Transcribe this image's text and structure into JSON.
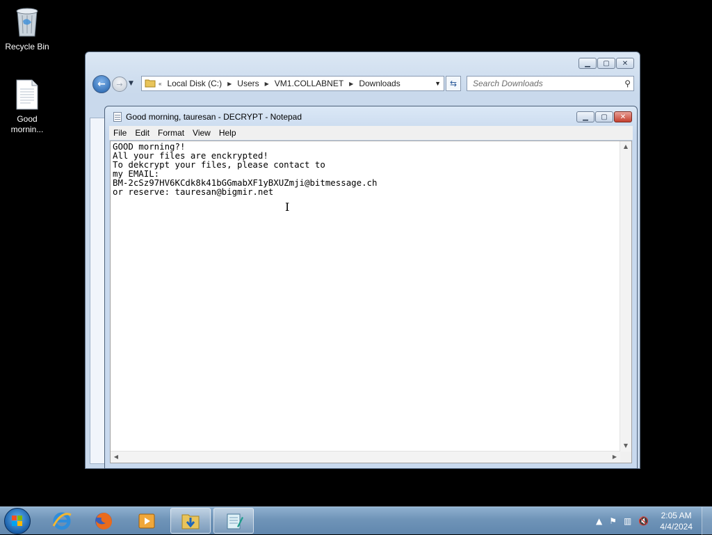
{
  "desktop": {
    "icons": [
      {
        "label": "Recycle Bin"
      },
      {
        "label_line1": "Good",
        "label_line2": "mornin..."
      }
    ]
  },
  "explorer": {
    "breadcrumb": [
      "Local Disk (C:)",
      "Users",
      "VM1.COLLABNET",
      "Downloads"
    ],
    "search_placeholder": "Search Downloads"
  },
  "notepad": {
    "title": "Good morning, tauresan - DECRYPT - Notepad",
    "menu": [
      "File",
      "Edit",
      "Format",
      "View",
      "Help"
    ],
    "content": "GOOD morning?!\nAll your files are enckrypted!\nTo dekcrypt your files, please contact to\nmy EMAIL:\nBM-2cSz97HV6KCdk8k41bGGmabXF1yBXUZmji@bitmessage.ch\nor reserve: tauresan@bigmir.net"
  },
  "taskbar": {
    "apps": [
      "internet-explorer-icon",
      "firefox-icon",
      "media-player-icon",
      "windows-explorer-icon",
      "notepad-icon"
    ],
    "active_app": "notepad",
    "clock_time": "2:05 AM",
    "clock_date": "4/4/2024"
  }
}
